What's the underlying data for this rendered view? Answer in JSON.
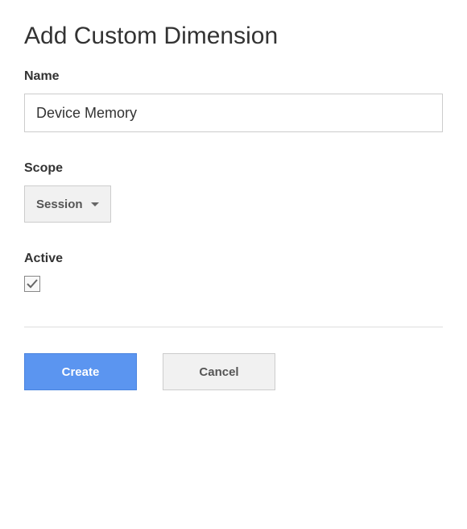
{
  "title": "Add Custom Dimension",
  "fields": {
    "name": {
      "label": "Name",
      "value": "Device Memory"
    },
    "scope": {
      "label": "Scope",
      "selected": "Session"
    },
    "active": {
      "label": "Active",
      "checked": true
    }
  },
  "buttons": {
    "create": "Create",
    "cancel": "Cancel"
  }
}
